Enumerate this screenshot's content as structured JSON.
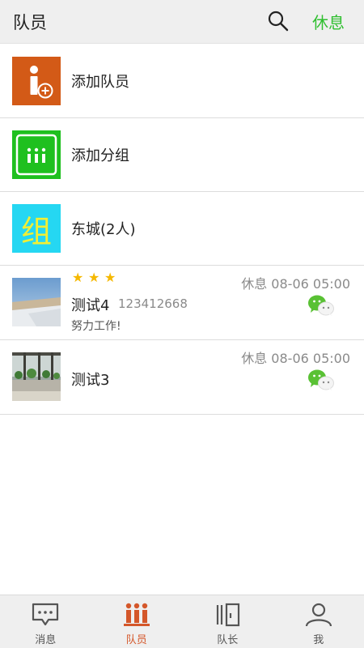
{
  "header": {
    "title": "队员",
    "rest_label": "休息",
    "search_icon": "search-icon"
  },
  "actions": [
    {
      "label": "添加队员",
      "icon": "add-member-icon",
      "color": "#d35a17"
    },
    {
      "label": "添加分组",
      "icon": "add-group-icon",
      "color": "#1fc01f"
    },
    {
      "label": "东城(2人)",
      "icon_text": "组",
      "color": "#25d7f2"
    }
  ],
  "members": [
    {
      "stars": 3,
      "name": "测试4",
      "phone": "123412668",
      "signature": "努力工作!",
      "status": "休息 08-06 05:00",
      "contact_icon": "wechat-icon"
    },
    {
      "stars": 0,
      "name": "测试3",
      "phone": "",
      "signature": "",
      "status": "休息 08-06 05:00",
      "contact_icon": "wechat-icon"
    }
  ],
  "tabs": [
    {
      "label": "消息",
      "icon": "message-icon",
      "active": false
    },
    {
      "label": "队员",
      "icon": "members-icon",
      "active": true
    },
    {
      "label": "队长",
      "icon": "captain-icon",
      "active": false
    },
    {
      "label": "我",
      "icon": "profile-icon",
      "active": false
    }
  ],
  "colors": {
    "accent_green": "#2fbf2f",
    "active_tab": "#d4572a",
    "star": "#f5b800"
  }
}
